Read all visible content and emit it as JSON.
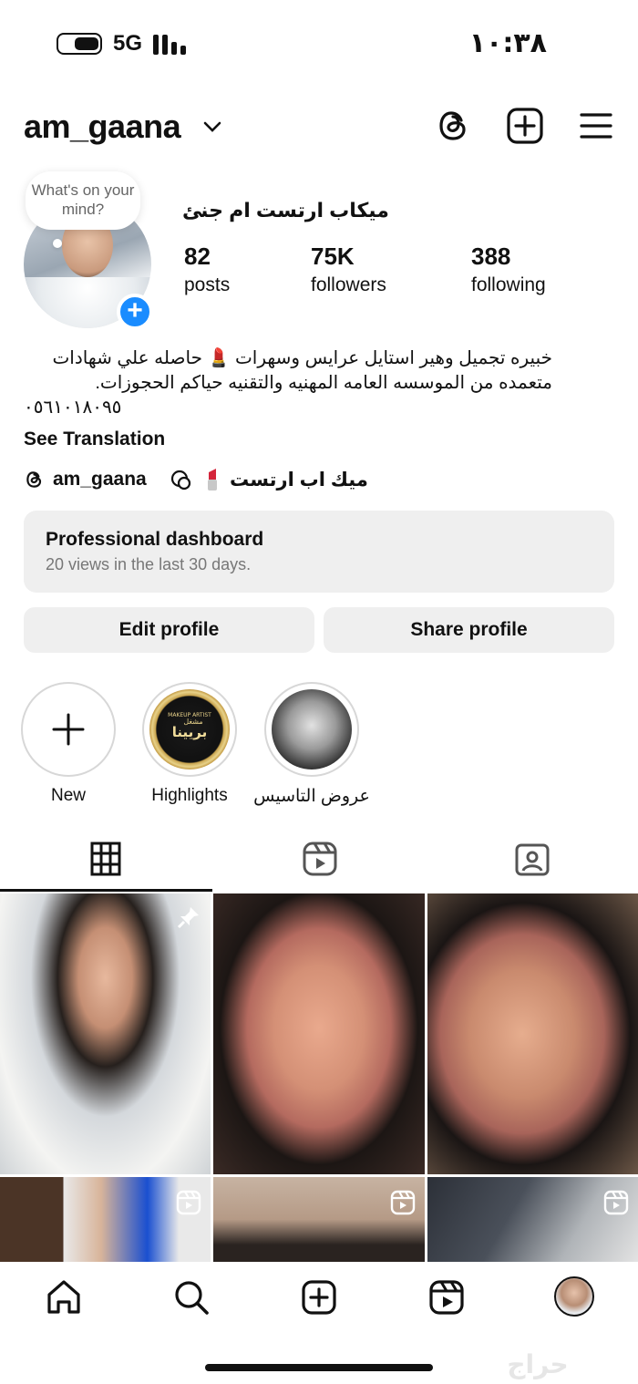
{
  "status_bar": {
    "network": "5G",
    "time": "١٠:٣٨"
  },
  "header": {
    "username": "am_gaana"
  },
  "profile": {
    "bubble_text": "What's on your mind?",
    "display_name": "ميكاب ارتست ام جنئ",
    "stats": [
      {
        "value": "82",
        "label": "posts"
      },
      {
        "value": "75K",
        "label": "followers"
      },
      {
        "value": "388",
        "label": "following"
      }
    ],
    "bio_line1": "خبيره تجميل وهير استايل عرايس وسهرات 💄 حاصله علي شهادات",
    "bio_line2": "متعمده من الموسسه العامه المهنيه والتقنيه حياكم الحجوزات.",
    "bio_phone": "٠٥٦١٠١٨٠٩٥",
    "see_translation": "See Translation",
    "threads_handle": "am_gaana",
    "link_title": "ميك اب ارتست"
  },
  "dashboard": {
    "title": "Professional dashboard",
    "subtitle": "20 views in the last 30 days."
  },
  "buttons": {
    "edit": "Edit profile",
    "share": "Share profile"
  },
  "highlights": [
    {
      "label": "New"
    },
    {
      "label": "Highlights",
      "badge_text_top": "MAKEUP ARTIST",
      "badge_text_main": "بريينا",
      "badge_text_sub": "مشغل"
    },
    {
      "label": "عروض التاسيس"
    }
  ],
  "tabs": [
    {
      "name": "grid",
      "active": true
    },
    {
      "name": "reels",
      "active": false
    },
    {
      "name": "tagged",
      "active": false
    }
  ],
  "colors": {
    "accent": "#1a8cff",
    "button_bg": "#efefef",
    "text": "#111111",
    "muted": "#777777"
  },
  "watermark": "حراج"
}
